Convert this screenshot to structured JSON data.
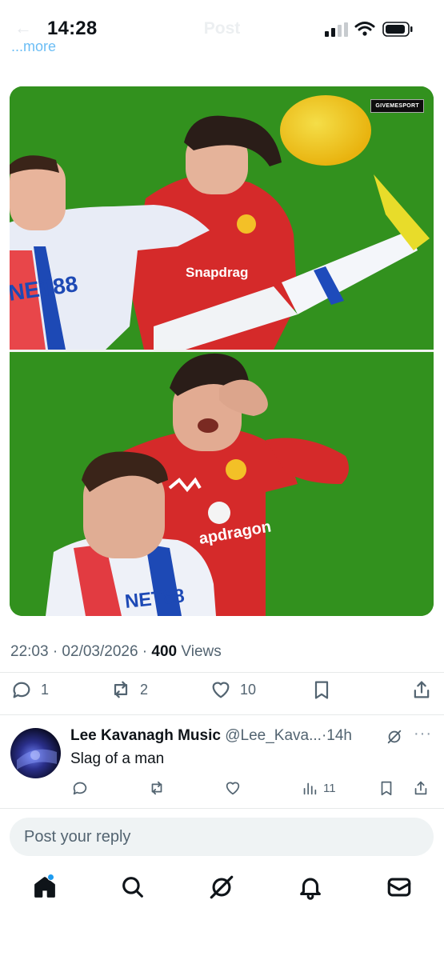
{
  "status": {
    "time": "14:28",
    "ghost_title": "Post"
  },
  "truncated_link": "...more",
  "media": {
    "watermark": "GIVEMESPORT"
  },
  "meta": {
    "time_date": "22:03 · 02/03/2026 · ",
    "views_count": "400",
    "views_label": " Views"
  },
  "actions": {
    "replies": "1",
    "reposts": "2",
    "likes": "10"
  },
  "reply": {
    "name": "Lee Kavanagh Music",
    "handle": "@Lee_Kava...",
    "age": "·14h",
    "text": "Slag of a man",
    "views": "11",
    "more": "···"
  },
  "composer": {
    "placeholder": "Post your reply"
  },
  "tabbar": {
    "items": [
      "home-icon",
      "search-icon",
      "grok-icon",
      "notifications-icon",
      "messages-icon"
    ]
  },
  "colors": {
    "accent": "#1d9bf0",
    "text": "#0f1419",
    "muted": "#536471",
    "pitch": "#2f8a1a"
  }
}
